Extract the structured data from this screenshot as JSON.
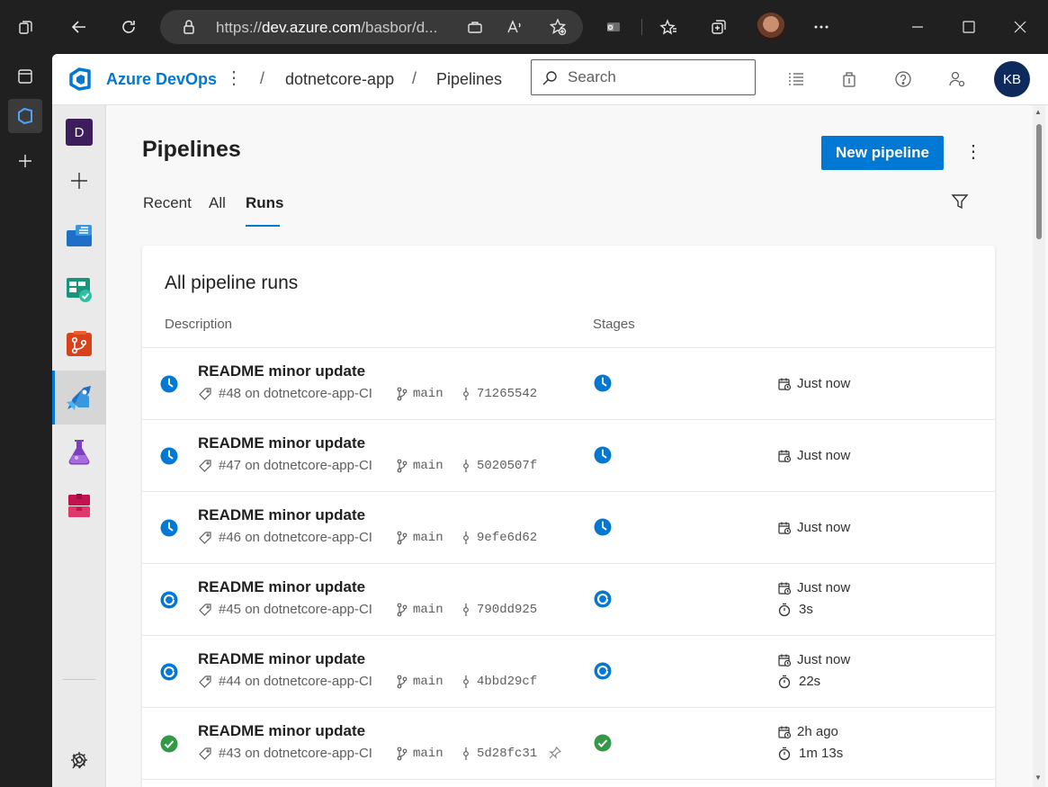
{
  "browser": {
    "url_prefix": "https://",
    "url_host": "dev.azure.com",
    "url_rest": "/basbor/d..."
  },
  "header": {
    "product": "Azure DevOps",
    "breadcrumb": [
      "dotnetcore-app",
      "Pipelines"
    ],
    "search_placeholder": "Search",
    "user_initials": "KB"
  },
  "sidebar": {
    "project_initial": "D"
  },
  "page": {
    "title": "Pipelines",
    "new_button": "New pipeline",
    "tabs": [
      "Recent",
      "All",
      "Runs"
    ],
    "active_tab": "Runs"
  },
  "card": {
    "title": "All pipeline runs",
    "columns": [
      "Description",
      "Stages"
    ]
  },
  "runs": [
    {
      "title": "README minor update",
      "number": "#48 on dotnetcore-app-CI",
      "branch": "main",
      "commit": "71265542",
      "status": "queued",
      "when": "Just now",
      "duration": ""
    },
    {
      "title": "README minor update",
      "number": "#47 on dotnetcore-app-CI",
      "branch": "main",
      "commit": "5020507f",
      "status": "queued",
      "when": "Just now",
      "duration": ""
    },
    {
      "title": "README minor update",
      "number": "#46 on dotnetcore-app-CI",
      "branch": "main",
      "commit": "9efe6d62",
      "status": "queued",
      "when": "Just now",
      "duration": ""
    },
    {
      "title": "README minor update",
      "number": "#45 on dotnetcore-app-CI",
      "branch": "main",
      "commit": "790dd925",
      "status": "running",
      "when": "Just now",
      "duration": "3s"
    },
    {
      "title": "README minor update",
      "number": "#44 on dotnetcore-app-CI",
      "branch": "main",
      "commit": "4bbd29cf",
      "status": "running",
      "when": "Just now",
      "duration": "22s"
    },
    {
      "title": "README minor update",
      "number": "#43 on dotnetcore-app-CI",
      "branch": "main",
      "commit": "5d28fc31",
      "status": "succeeded",
      "when": "2h ago",
      "duration": "1m 13s"
    }
  ],
  "colors": {
    "accent": "#0078d4",
    "success": "#339947",
    "header_avatar": "#0e2a5c"
  }
}
